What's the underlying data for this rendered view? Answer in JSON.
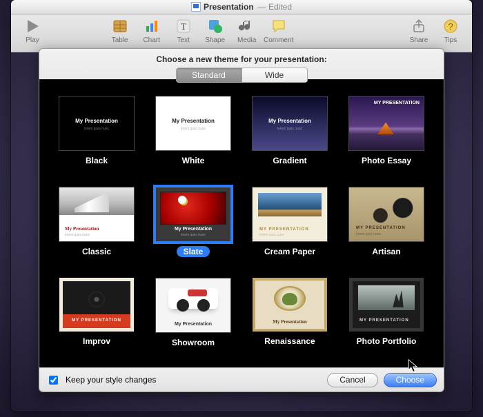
{
  "title": {
    "name": "Presentation",
    "status": "Edited"
  },
  "toolbar": {
    "play": "Play",
    "table": "Table",
    "chart": "Chart",
    "text": "Text",
    "shape": "Shape",
    "media": "Media",
    "comment": "Comment",
    "share": "Share",
    "tips": "Tips"
  },
  "sheet": {
    "heading": "Choose a new theme for your presentation:",
    "seg": {
      "standard": "Standard",
      "wide": "Wide"
    },
    "sample": {
      "title": "My Presentation",
      "sub": "lorem ipsis nunc",
      "upper": "MY PRESENTATION"
    }
  },
  "themes": [
    {
      "name": "Black"
    },
    {
      "name": "White"
    },
    {
      "name": "Gradient"
    },
    {
      "name": "Photo Essay"
    },
    {
      "name": "Classic"
    },
    {
      "name": "Slate"
    },
    {
      "name": "Cream Paper"
    },
    {
      "name": "Artisan"
    },
    {
      "name": "Improv"
    },
    {
      "name": "Showroom"
    },
    {
      "name": "Renaissance"
    },
    {
      "name": "Photo Portfolio"
    }
  ],
  "footer": {
    "keep": "Keep your style changes",
    "cancel": "Cancel",
    "choose": "Choose"
  }
}
